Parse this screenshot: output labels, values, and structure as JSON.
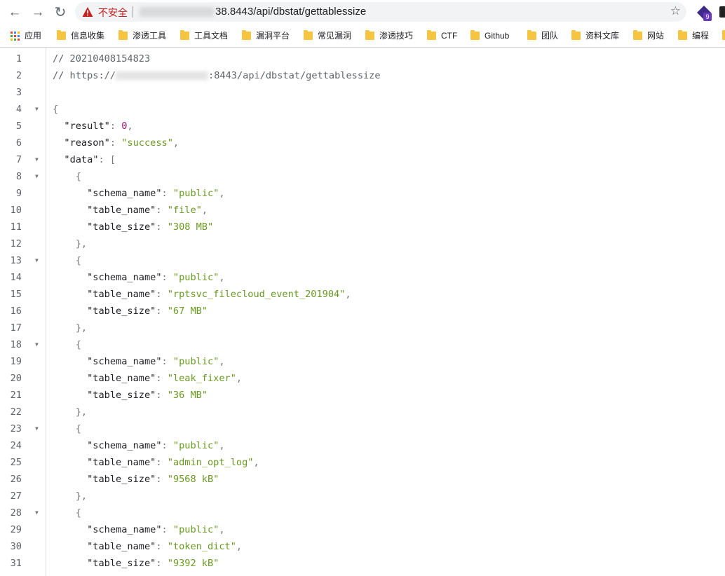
{
  "browser": {
    "security_label": "不安全",
    "url_path": "38.8443/api/dbstat/gettablessize",
    "extension_badge": "9"
  },
  "bookmarks": [
    {
      "label": "应用",
      "type": "apps"
    },
    {
      "label": "信息收集",
      "type": "folder"
    },
    {
      "label": "渗透工具",
      "type": "folder"
    },
    {
      "label": "工具文档",
      "type": "folder"
    },
    {
      "label": "漏洞平台",
      "type": "folder"
    },
    {
      "label": "常见漏洞",
      "type": "folder"
    },
    {
      "label": "渗透技巧",
      "type": "folder"
    },
    {
      "label": "CTF",
      "type": "folder"
    },
    {
      "label": "Github",
      "type": "folder"
    },
    {
      "label": "团队",
      "type": "folder"
    },
    {
      "label": "资料文库",
      "type": "folder"
    },
    {
      "label": "网站",
      "type": "folder"
    },
    {
      "label": "编程",
      "type": "folder"
    }
  ],
  "code": {
    "comment_timestamp": "// 20210408154823",
    "comment_url_prefix": "// https://",
    "comment_url_suffix": ":8443/api/dbstat/gettablessize",
    "result_key": "result",
    "result_value": "0",
    "reason_key": "reason",
    "reason_value": "success",
    "data_key": "data",
    "schema_key": "schema_name",
    "table_name_key": "table_name",
    "table_size_key": "table_size",
    "items": [
      {
        "schema_name": "public",
        "table_name": "file",
        "table_size": "308 MB"
      },
      {
        "schema_name": "public",
        "table_name": "rptsvc_filecloud_event_201904",
        "table_size": "67 MB"
      },
      {
        "schema_name": "public",
        "table_name": "leak_fixer",
        "table_size": "36 MB"
      },
      {
        "schema_name": "public",
        "table_name": "admin_opt_log",
        "table_size": "9568 kB"
      },
      {
        "schema_name": "public",
        "table_name": "token_dict",
        "table_size": "9392 kB"
      }
    ]
  }
}
